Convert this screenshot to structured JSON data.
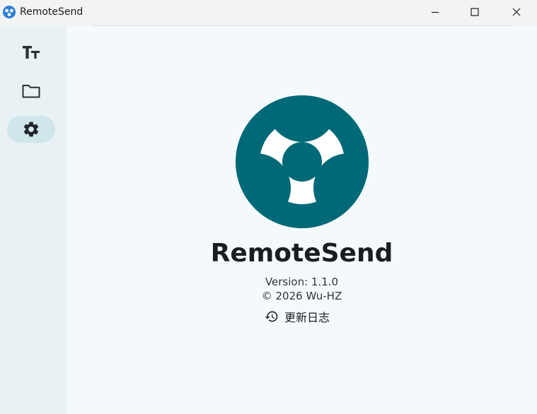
{
  "window": {
    "title": "RemoteSend",
    "accent_color": "#006978"
  },
  "sidebar": {
    "items": [
      {
        "id": "text",
        "icon": "text-size-icon",
        "active": false
      },
      {
        "id": "files",
        "icon": "folder-icon",
        "active": false
      },
      {
        "id": "settings",
        "icon": "gear-icon",
        "active": true
      }
    ]
  },
  "about": {
    "product_name": "RemoteSend",
    "version": "Version: 1.1.0",
    "copyright": "© 2026 Wu-HZ",
    "changelog_label": "更新日志",
    "changelog_icon": "history-icon"
  }
}
